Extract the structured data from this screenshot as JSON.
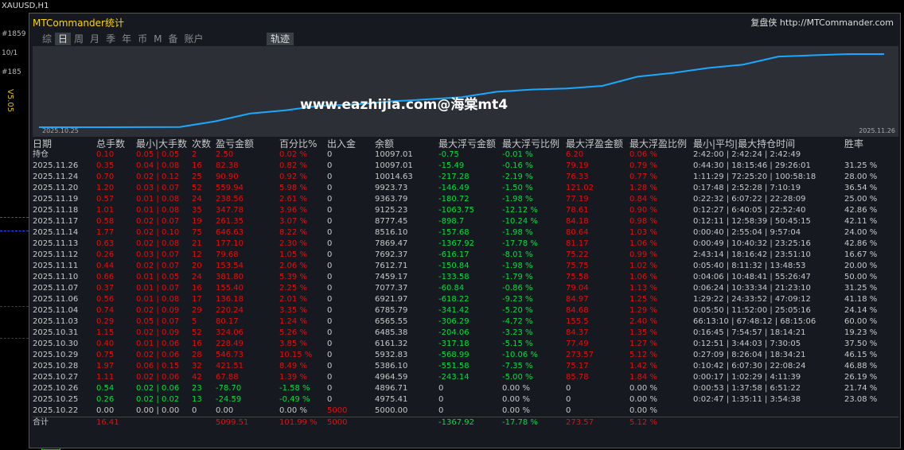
{
  "chart": {
    "symbol": "XAUUSD,H1",
    "version_label": "V5.05",
    "left_labels": [
      "#1859",
      "10/1",
      "#185"
    ]
  },
  "window": {
    "title": "MTCommander统计",
    "link": "复盘侠 http://MTCommander.com",
    "tabs": [
      "综",
      "日",
      "周",
      "月",
      "季",
      "年",
      "币",
      "M",
      "备",
      "账户"
    ],
    "active_tab": "日",
    "track_button": "轨迹",
    "start_date": "2025.10.25",
    "end_date": "2025.11.26",
    "watermark": "www.eazhijia.com@海棠mt4"
  },
  "equity_curve": [
    4975,
    4975,
    4976,
    4980,
    4990,
    5386,
    5933,
    6161,
    6485,
    6566,
    6786,
    6922,
    7077,
    7459,
    7612,
    7692,
    7869,
    8516,
    8777,
    9125,
    9363,
    9924,
    10015,
    10097,
    10097
  ],
  "table": {
    "headers": [
      "日期",
      "总手数",
      "最小|大手数",
      "次数",
      "盈亏金额",
      "百分比%",
      "出入金",
      "余额",
      "最大浮亏金额",
      "最大浮亏比例",
      "最大浮盈金额",
      "最大浮盈比例",
      "最小|平均|最大持仓时间",
      "胜率"
    ],
    "holding": {
      "label": "持仓",
      "lots": "0.10",
      "minmax": "0.05 | 0.05",
      "count": "2",
      "pnl": "2.50",
      "pct": "0.02 %",
      "io": "0",
      "bal": "10097.01",
      "mfl": "-0.75",
      "mflp": "-0.01 %",
      "mfp": "6.20",
      "mfpp": "0.06 %",
      "time": "2:42:00 | 2:42:24 | 2:42:49",
      "win": ""
    },
    "rows": [
      {
        "date": "2025.11.26",
        "lots": "0.35",
        "minmax": "0.04 | 0.08",
        "count": "16",
        "pnl": "82.38",
        "pct": "0.82 %",
        "io": "0",
        "bal": "10097.01",
        "mfl": "-15.49",
        "mflp": "-0.16 %",
        "mfp": "79.19",
        "mfpp": "0.79 %",
        "time": "0:44:30 | 18:15:46 | 29:26:01",
        "win": "31.25 %",
        "c": "r"
      },
      {
        "date": "2025.11.24",
        "lots": "0.70",
        "minmax": "0.02 | 0.12",
        "count": "25",
        "pnl": "90.90",
        "pct": "0.92 %",
        "io": "0",
        "bal": "10014.63",
        "mfl": "-217.28",
        "mflp": "-2.19 %",
        "mfp": "76.33",
        "mfpp": "0.77 %",
        "time": "1:11:29 | 72:25:20 | 100:58:18",
        "win": "28.00 %",
        "c": "r"
      },
      {
        "date": "2025.11.20",
        "lots": "1.20",
        "minmax": "0.03 | 0.07",
        "count": "52",
        "pnl": "559.94",
        "pct": "5.98 %",
        "io": "0",
        "bal": "9923.73",
        "mfl": "-146.49",
        "mflp": "-1.50 %",
        "mfp": "121.02",
        "mfpp": "1.28 %",
        "time": "0:17:48 | 2:52:28 | 7:10:19",
        "win": "36.54 %",
        "c": "r"
      },
      {
        "date": "2025.11.19",
        "lots": "0.57",
        "minmax": "0.01 | 0.08",
        "count": "24",
        "pnl": "238.56",
        "pct": "2.61 %",
        "io": "0",
        "bal": "9363.79",
        "mfl": "-180.72",
        "mflp": "-1.98 %",
        "mfp": "77.19",
        "mfpp": "0.84 %",
        "time": "0:22:32 | 6:07:22 | 22:28:09",
        "win": "25.00 %",
        "c": "r"
      },
      {
        "date": "2025.11.18",
        "lots": "1.01",
        "minmax": "0.01 | 0.08",
        "count": "35",
        "pnl": "347.78",
        "pct": "3.96 %",
        "io": "0",
        "bal": "9125.23",
        "mfl": "-1063.75",
        "mflp": "-12.12 %",
        "mfp": "78.61",
        "mfpp": "0.90 %",
        "time": "0:12:27 | 6:40:05 | 22:52:40",
        "win": "42.86 %",
        "c": "r"
      },
      {
        "date": "2025.11.17",
        "lots": "0.58",
        "minmax": "0.02 | 0.07",
        "count": "19",
        "pnl": "261.35",
        "pct": "3.07 %",
        "io": "0",
        "bal": "8777.45",
        "mfl": "-898.7",
        "mflp": "-10.24 %",
        "mfp": "84.18",
        "mfpp": "0.98 %",
        "time": "0:12:11 | 12:58:39 | 50:45:15",
        "win": "42.11 %",
        "c": "r"
      },
      {
        "date": "2025.11.14",
        "lots": "1.77",
        "minmax": "0.02 | 0.10",
        "count": "75",
        "pnl": "646.63",
        "pct": "8.22 %",
        "io": "0",
        "bal": "8516.10",
        "mfl": "-157.68",
        "mflp": "-1.98 %",
        "mfp": "80.64",
        "mfpp": "1.03 %",
        "time": "0:00:40 | 2:55:04 | 9:57:04",
        "win": "24.00 %",
        "c": "r"
      },
      {
        "date": "2025.11.13",
        "lots": "0.63",
        "minmax": "0.02 | 0.08",
        "count": "21",
        "pnl": "177.10",
        "pct": "2.30 %",
        "io": "0",
        "bal": "7869.47",
        "mfl": "-1367.92",
        "mflp": "-17.78 %",
        "mfp": "81.17",
        "mfpp": "1.06 %",
        "time": "0:00:49 | 10:40:32 | 23:25:16",
        "win": "42.86 %",
        "c": "r"
      },
      {
        "date": "2025.11.12",
        "lots": "0.26",
        "minmax": "0.03 | 0.07",
        "count": "12",
        "pnl": "79.68",
        "pct": "1.05 %",
        "io": "0",
        "bal": "7692.37",
        "mfl": "-616.17",
        "mflp": "-8.01 %",
        "mfp": "75.22",
        "mfpp": "0.99 %",
        "time": "2:43:14 | 18:16:42 | 23:51:10",
        "win": "16.67 %",
        "c": "r"
      },
      {
        "date": "2025.11.11",
        "lots": "0.44",
        "minmax": "0.02 | 0.07",
        "count": "20",
        "pnl": "153.54",
        "pct": "2.06 %",
        "io": "0",
        "bal": "7612.71",
        "mfl": "-150.84",
        "mflp": "-1.98 %",
        "mfp": "75.75",
        "mfpp": "1.02 %",
        "time": "0:05:40 | 8:11:32 | 13:48:53",
        "win": "20.00 %",
        "c": "r"
      },
      {
        "date": "2025.11.10",
        "lots": "0.66",
        "minmax": "0.01 | 0.05",
        "count": "24",
        "pnl": "381.80",
        "pct": "5.39 %",
        "io": "0",
        "bal": "7459.17",
        "mfl": "-133.58",
        "mflp": "-1.79 %",
        "mfp": "75.58",
        "mfpp": "1.06 %",
        "time": "0:04:06 | 10:48:41 | 55:26:47",
        "win": "50.00 %",
        "c": "r"
      },
      {
        "date": "2025.11.07",
        "lots": "0.37",
        "minmax": "0.01 | 0.07",
        "count": "16",
        "pnl": "155.40",
        "pct": "2.25 %",
        "io": "0",
        "bal": "7077.37",
        "mfl": "-60.84",
        "mflp": "-0.86 %",
        "mfp": "79.04",
        "mfpp": "1.13 %",
        "time": "0:06:24 | 10:33:34 | 21:23:10",
        "win": "31.25 %",
        "c": "r"
      },
      {
        "date": "2025.11.06",
        "lots": "0.56",
        "minmax": "0.01 | 0.08",
        "count": "17",
        "pnl": "136.18",
        "pct": "2.01 %",
        "io": "0",
        "bal": "6921.97",
        "mfl": "-618.22",
        "mflp": "-9.23 %",
        "mfp": "84.97",
        "mfpp": "1.25 %",
        "time": "1:29:22 | 24:33:52 | 47:09:12",
        "win": "41.18 %",
        "c": "r"
      },
      {
        "date": "2025.11.04",
        "lots": "0.74",
        "minmax": "0.02 | 0.09",
        "count": "29",
        "pnl": "220.24",
        "pct": "3.35 %",
        "io": "0",
        "bal": "6785.79",
        "mfl": "-341.42",
        "mflp": "-5.20 %",
        "mfp": "84.68",
        "mfpp": "1.29 %",
        "time": "0:05:50 | 11:52:00 | 25:05:16",
        "win": "24.14 %",
        "c": "r"
      },
      {
        "date": "2025.11.03",
        "lots": "0.29",
        "minmax": "0.05 | 0.07",
        "count": "5",
        "pnl": "80.17",
        "pct": "1.24 %",
        "io": "0",
        "bal": "6565.55",
        "mfl": "-306.29",
        "mflp": "-4.72 %",
        "mfp": "155.5",
        "mfpp": "2.40 %",
        "time": "66:13:10 | 67:48:12 | 68:15:06",
        "win": "60.00 %",
        "c": "r"
      },
      {
        "date": "2025.10.31",
        "lots": "1.15",
        "minmax": "0.02 | 0.09",
        "count": "52",
        "pnl": "324.06",
        "pct": "5.26 %",
        "io": "0",
        "bal": "6485.38",
        "mfl": "-204.06",
        "mflp": "-3.23 %",
        "mfp": "84.37",
        "mfpp": "1.35 %",
        "time": "0:16:45 | 7:54:57 | 18:14:21",
        "win": "19.23 %",
        "c": "r"
      },
      {
        "date": "2025.10.30",
        "lots": "0.40",
        "minmax": "0.01 | 0.06",
        "count": "16",
        "pnl": "228.49",
        "pct": "3.85 %",
        "io": "0",
        "bal": "6161.32",
        "mfl": "-317.18",
        "mflp": "-5.15 %",
        "mfp": "77.49",
        "mfpp": "1.27 %",
        "time": "0:12:51 | 3:44:03 | 7:30:05",
        "win": "37.50 %",
        "c": "r"
      },
      {
        "date": "2025.10.29",
        "lots": "0.75",
        "minmax": "0.02 | 0.06",
        "count": "28",
        "pnl": "546.73",
        "pct": "10.15 %",
        "io": "0",
        "bal": "5932.83",
        "mfl": "-568.99",
        "mflp": "-10.06 %",
        "mfp": "273.57",
        "mfpp": "5.12 %",
        "time": "0:27:09 | 8:26:04 | 18:34:21",
        "win": "46.15 %",
        "c": "r"
      },
      {
        "date": "2025.10.28",
        "lots": "1.97",
        "minmax": "0.06 | 0.15",
        "count": "32",
        "pnl": "421.51",
        "pct": "8.49 %",
        "io": "0",
        "bal": "5386.10",
        "mfl": "-551.58",
        "mflp": "-7.35 %",
        "mfp": "75.17",
        "mfpp": "1.42 %",
        "time": "0:10:42 | 6:07:30 | 22:08:24",
        "win": "46.88 %",
        "c": "r"
      },
      {
        "date": "2025.10.27",
        "lots": "1.11",
        "minmax": "0.02 | 0.06",
        "count": "42",
        "pnl": "67.88",
        "pct": "1.39 %",
        "io": "0",
        "bal": "4964.59",
        "mfl": "-243.14",
        "mflp": "-5.00 %",
        "mfp": "85.78",
        "mfpp": "1.84 %",
        "time": "0:00:17 | 1:02:29 | 4:11:39",
        "win": "26.19 %",
        "c": "r"
      },
      {
        "date": "2025.10.26",
        "lots": "0.54",
        "minmax": "0.02 | 0.06",
        "count": "23",
        "pnl": "-78.70",
        "pct": "-1.58 %",
        "io": "0",
        "bal": "4896.71",
        "mfl": "0",
        "mflp": "0.00 %",
        "mfp": "0",
        "mfpp": "0.00 %",
        "time": "0:00:53 | 1:37:58 | 6:51:22",
        "win": "21.74 %",
        "c": "g"
      },
      {
        "date": "2025.10.25",
        "lots": "0.26",
        "minmax": "0.02 | 0.02",
        "count": "13",
        "pnl": "-24.59",
        "pct": "-0.49 %",
        "io": "0",
        "bal": "4975.41",
        "mfl": "0",
        "mflp": "0.00 %",
        "mfp": "0",
        "mfpp": "0.00 %",
        "time": "0:02:47 | 1:35:11 | 3:54:38",
        "win": "23.08 %",
        "c": "g"
      },
      {
        "date": "2025.10.22",
        "lots": "0.00",
        "minmax": "0.00 | 0.00",
        "count": "0",
        "pnl": "0.00",
        "pct": "0.00 %",
        "io": "5000",
        "bal": "5000.00",
        "mfl": "0",
        "mflp": "0.00 %",
        "mfp": "0",
        "mfpp": "0.00 %",
        "time": "",
        "win": "",
        "c": "w"
      }
    ],
    "total": {
      "label": "合计",
      "lots": "16.41",
      "pnl": "5099.51",
      "pct": "101.99 %",
      "io": "5000",
      "mfl": "-1367.92",
      "mflp": "-17.78 %",
      "mfp": "273.57",
      "mfpp": "5.12 %"
    }
  },
  "colors": {
    "loss": "#e01010",
    "gain": "#00dd44",
    "neutral": "#c8c8c8",
    "curve": "#1aa8ff"
  }
}
